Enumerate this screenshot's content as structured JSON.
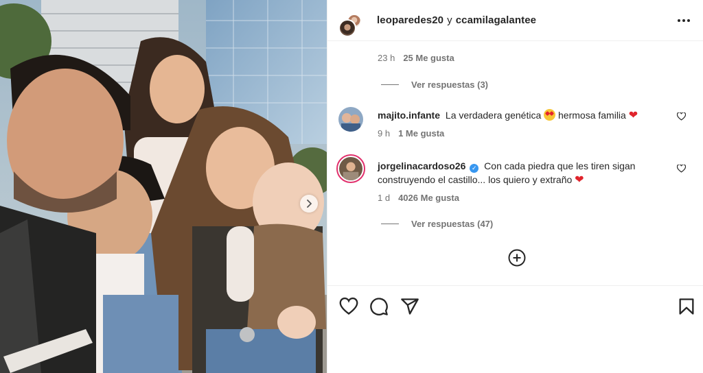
{
  "post": {
    "authors": {
      "first": "leoparedes20",
      "conjunction": "y",
      "second": "ccamilagalantee"
    }
  },
  "prev_comment": {
    "time": "23 h",
    "likes": "25 Me gusta",
    "replies_label": "Ver respuestas (3)"
  },
  "comments": [
    {
      "username": "majito.infante",
      "text_before": "La verdadera genética",
      "text_after": "hermosa familia",
      "time": "9 h",
      "likes": "1 Me gusta",
      "avatar_icon": "user-avatar"
    },
    {
      "username": "jorgelinacardoso26",
      "verified": true,
      "text": "Con cada piedra que les tiren sigan construyendo el castillo... los quiero y extraño",
      "time": "1 d",
      "likes": "4026 Me gusta",
      "replies_label": "Ver respuestas (47)",
      "avatar_icon": "user-avatar"
    }
  ],
  "icons": {
    "more": "more-options-icon",
    "heart": "heart-icon",
    "comment": "comment-icon",
    "share": "share-icon",
    "save": "bookmark-icon",
    "add": "add-circle-icon",
    "next": "chevron-right-icon"
  },
  "colors": {
    "accent_red": "#e0242c",
    "verified_blue": "#3897f0",
    "muted_text": "#737373"
  }
}
